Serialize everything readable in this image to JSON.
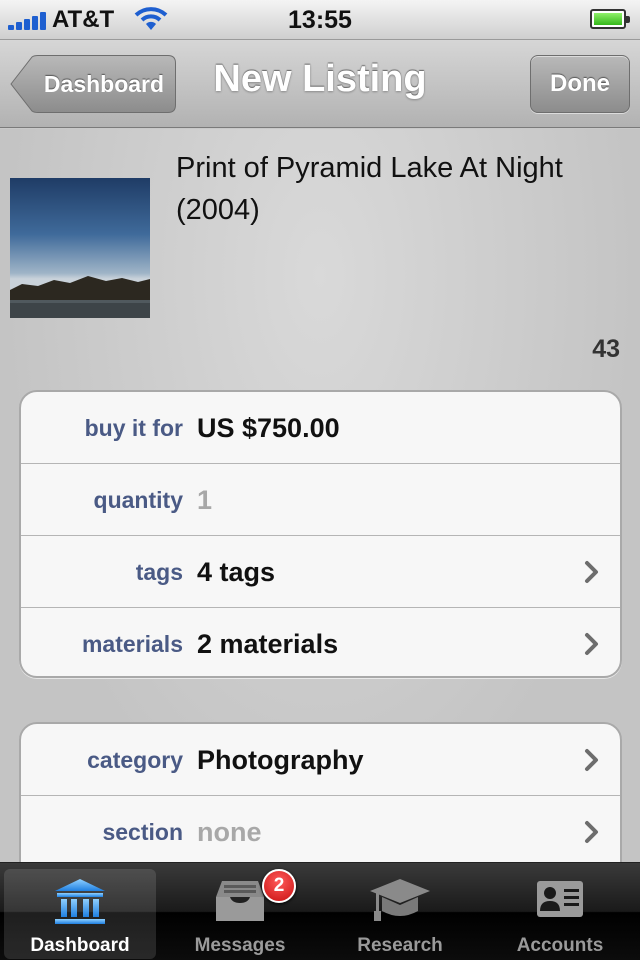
{
  "status_bar": {
    "carrier": "AT&T",
    "time": "13:55"
  },
  "nav": {
    "back_label": "Dashboard",
    "title": "New Listing",
    "done_label": "Done"
  },
  "listing": {
    "title": "Print of Pyramid Lake At Night (2004)",
    "char_count": "43"
  },
  "details_group": [
    {
      "key": "buy it for",
      "value": "US $750.00",
      "muted": false,
      "disclosure": false
    },
    {
      "key": "quantity",
      "value": "1",
      "muted": true,
      "disclosure": false
    },
    {
      "key": "tags",
      "value": "4 tags",
      "muted": false,
      "disclosure": true
    },
    {
      "key": "materials",
      "value": "2 materials",
      "muted": false,
      "disclosure": true
    }
  ],
  "category_group": [
    {
      "key": "category",
      "value": "Photography",
      "muted": false,
      "disclosure": true
    },
    {
      "key": "section",
      "value": "none",
      "muted": true,
      "disclosure": true
    }
  ],
  "tab_bar": {
    "tabs": [
      {
        "label": "Dashboard",
        "icon": "bank-building-icon",
        "active": true
      },
      {
        "label": "Messages",
        "icon": "inbox-tray-icon",
        "active": false,
        "badge": "2"
      },
      {
        "label": "Research",
        "icon": "graduation-cap-icon",
        "active": false
      },
      {
        "label": "Accounts",
        "icon": "id-card-icon",
        "active": false
      }
    ]
  },
  "colors": {
    "label_blue": "#4a5a85",
    "active_tab_blue": "#2f8ff0",
    "badge_red": "#d41a1a"
  }
}
